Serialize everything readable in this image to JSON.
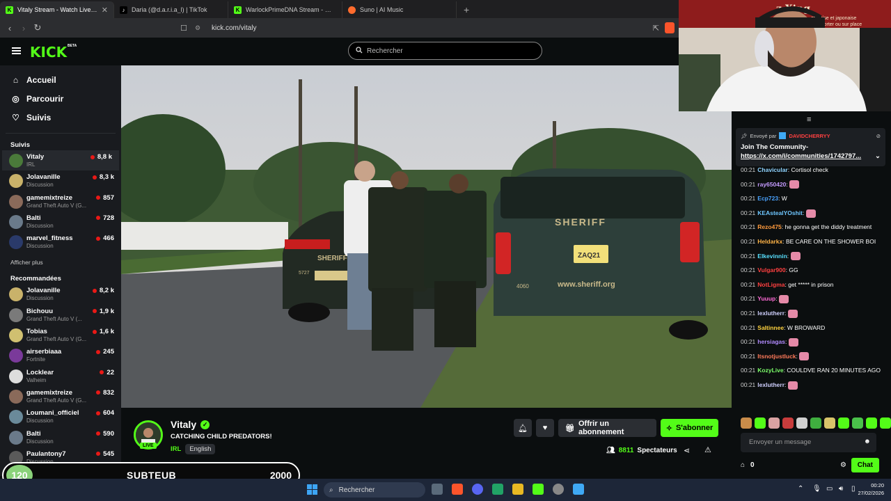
{
  "browser": {
    "tabs": [
      {
        "title": "Vitaly Stream - Watch Live on Kick",
        "icon": "kick-icon",
        "active": true,
        "color": "#53fc18"
      },
      {
        "title": "Daria (@d.a.r.i.a_l) | TikTok",
        "icon": "tiktok-icon",
        "active": false,
        "color": "#ffffff"
      },
      {
        "title": "WarlockPrimeDNA Stream - Watch Live on Kick",
        "icon": "kick-icon",
        "active": false,
        "color": "#53fc18"
      },
      {
        "title": "Suno | AI Music",
        "icon": "suno-icon",
        "active": false,
        "color": "#ff6b2d"
      }
    ],
    "url": "kick.com/vitaly"
  },
  "kick": {
    "logo": "KICK",
    "logo_badge": "BETA",
    "search_placeholder": "Rechercher",
    "nav": [
      {
        "label": "Accueil",
        "icon": "home-icon"
      },
      {
        "label": "Parcourir",
        "icon": "compass-icon"
      },
      {
        "label": "Suivis",
        "icon": "heart-icon"
      }
    ],
    "followed_title": "Suivis",
    "followed": [
      {
        "name": "Vitaly",
        "category": "IRL",
        "viewers": "8,8 k",
        "color": "#4a7a3a"
      },
      {
        "name": "Jolavanille",
        "category": "Discussion",
        "viewers": "8,3 k",
        "color": "#c9b26a"
      },
      {
        "name": "gamemixtreize",
        "category": "Grand Theft Auto V (G...",
        "viewers": "857",
        "color": "#8a6a5a"
      },
      {
        "name": "Balti",
        "category": "Discussion",
        "viewers": "728",
        "color": "#6a7a8a"
      },
      {
        "name": "marvel_fitness",
        "category": "Discussion",
        "viewers": "466",
        "color": "#2a3a6a"
      }
    ],
    "show_more": "Afficher plus",
    "recommended_title": "Recommandées",
    "recommended": [
      {
        "name": "Jolavanille",
        "category": "Discussion",
        "viewers": "8,2 k",
        "color": "#c9b26a"
      },
      {
        "name": "Bichouu",
        "category": "Grand Theft Auto V (...",
        "viewers": "1,9 k",
        "color": "#7a7a7a"
      },
      {
        "name": "Tobias",
        "category": "Grand Theft Auto V (G...",
        "viewers": "1,6 k",
        "color": "#d0c070"
      },
      {
        "name": "airserbiaaa",
        "category": "Fortnite",
        "viewers": "245",
        "color": "#7a3a9a"
      },
      {
        "name": "Locklear",
        "category": "Valheim",
        "viewers": "22",
        "color": "#dddddd"
      },
      {
        "name": "gamemixtreize",
        "category": "Grand Theft Auto V (G...",
        "viewers": "832",
        "color": "#8a6a5a"
      },
      {
        "name": "Loumani_officiel",
        "category": "Discussion",
        "viewers": "604",
        "color": "#6a8a9a"
      },
      {
        "name": "Balti",
        "category": "Discussion",
        "viewers": "590",
        "color": "#6a7a8a"
      },
      {
        "name": "Paulantony7",
        "category": "Discussion",
        "viewers": "545",
        "color": "#5a5a5a"
      }
    ]
  },
  "stream": {
    "streamer": "Vitaly",
    "live_badge": "LIVE",
    "title": "CATCHING CHILD PREDATORS!",
    "category": "IRL",
    "language": "English",
    "gift_label": "Offrir un abonnement",
    "subscribe_label": "S'abonner",
    "viewers_count": "8811",
    "viewers_label": "Spectateurs",
    "car_left_text": "SHERIFF",
    "car_right_text": "SHERIFF",
    "car_right_url": "www.sheriff.org",
    "car_left_plate": "5727",
    "car_right_plate": "4060",
    "plate_text": "ZAQ21"
  },
  "chat": {
    "pinned_by_label": "Envoyé par",
    "pinned_user": "DAVIDCHERRYY",
    "pinned_text": "Join The Community-",
    "pinned_link": "https://x.com/i/communities/1742797...",
    "messages": [
      {
        "time": "00:21",
        "user": "Chavicular",
        "color": "#8fd3ff",
        "text": "Cortisol check"
      },
      {
        "time": "00:21",
        "user": "ray650420",
        "color": "#c49bff",
        "text": ""
      },
      {
        "time": "00:21",
        "user": "Ecp723",
        "color": "#4aa3ff",
        "text": "W"
      },
      {
        "time": "00:21",
        "user": "KEAstealYOshit",
        "color": "#6ec6ff",
        "text": ""
      },
      {
        "time": "00:21",
        "user": "Rezo475",
        "color": "#ff9a3d",
        "text": "he gonna get the diddy treatment"
      },
      {
        "time": "00:21",
        "user": "Heldarkx",
        "color": "#ffb347",
        "text": "BE CARE ON THE SHOWER BOI"
      },
      {
        "time": "00:21",
        "user": "Elkevinnin",
        "color": "#58e0ff",
        "text": ""
      },
      {
        "time": "00:21",
        "user": "Vulgar900",
        "color": "#ff4040",
        "text": "GG"
      },
      {
        "time": "00:21",
        "user": "NotLigma",
        "color": "#ff4040",
        "text": "get ***** in prison"
      },
      {
        "time": "00:21",
        "user": "Yuuup",
        "color": "#ff6bd6",
        "text": ""
      },
      {
        "time": "00:21",
        "user": "lexlutherr",
        "color": "#d0d0ff",
        "text": ""
      },
      {
        "time": "00:21",
        "user": "Saltinnee",
        "color": "#ffd23f",
        "text": "W BROWARD"
      },
      {
        "time": "00:21",
        "user": "hersiagas",
        "color": "#b28bff",
        "text": ""
      },
      {
        "time": "00:21",
        "user": "Itsnotjustluck",
        "color": "#ff7a5a",
        "text": ""
      },
      {
        "time": "00:21",
        "user": "KozyLive",
        "color": "#7dff6b",
        "text": "COULDVE RAN 20 MINUTES AGO"
      },
      {
        "time": "00:21",
        "user": "lexlutherr",
        "color": "#d0d0ff",
        "text": ""
      }
    ],
    "input_placeholder": "Envoyer un message",
    "points": "0",
    "send_label": "Chat"
  },
  "overlay": {
    "current": "120",
    "label": "SUBTEUB",
    "target": "2000"
  },
  "webcam": {
    "sign_text": "z Xing",
    "sign_sub": "chinoise et japonaise",
    "sign_sub2": "emporter ou sur place"
  },
  "taskbar": {
    "search_label": "Rechercher",
    "time": "00:20",
    "date": "27/02/2026"
  }
}
